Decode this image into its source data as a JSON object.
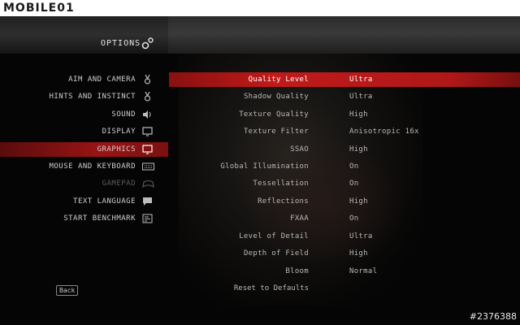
{
  "watermark": {
    "brand": "MOBILE01",
    "image_id": "#2376388"
  },
  "header": {
    "title": "OPTIONS"
  },
  "menu": {
    "items": [
      {
        "label": "AIM AND CAMERA",
        "icon": "medal-icon"
      },
      {
        "label": "HINTS AND INSTINCT",
        "icon": "medal-icon"
      },
      {
        "label": "SOUND",
        "icon": "speaker-icon"
      },
      {
        "label": "DISPLAY",
        "icon": "monitor-icon"
      },
      {
        "label": "GRAPHICS",
        "icon": "monitor-icon",
        "selected": true
      },
      {
        "label": "MOUSE AND KEYBOARD",
        "icon": "keyboard-icon"
      },
      {
        "label": "GAMEPAD",
        "icon": "gamepad-icon",
        "disabled": true
      },
      {
        "label": "TEXT LANGUAGE",
        "icon": "speech-bubble-icon"
      },
      {
        "label": "START BENCHMARK",
        "icon": "chart-icon"
      }
    ],
    "back_label": "Back"
  },
  "settings": [
    {
      "name": "Quality Level",
      "value": "Ultra",
      "selected": true
    },
    {
      "name": "Shadow Quality",
      "value": "Ultra"
    },
    {
      "name": "Texture Quality",
      "value": "High"
    },
    {
      "name": "Texture Filter",
      "value": "Anisotropic 16x"
    },
    {
      "name": "SSAO",
      "value": "High"
    },
    {
      "name": "Global Illumination",
      "value": "On"
    },
    {
      "name": "Tessellation",
      "value": "On"
    },
    {
      "name": "Reflections",
      "value": "High"
    },
    {
      "name": "FXAA",
      "value": "On"
    },
    {
      "name": "Level of Detail",
      "value": "Ultra"
    },
    {
      "name": "Depth of Field",
      "value": "High"
    },
    {
      "name": "Bloom",
      "value": "Normal"
    }
  ],
  "reset_label": "Reset to Defaults",
  "colors": {
    "accent_red": "#c01a1a",
    "menu_selected": "#9a1414",
    "text": "#c9c9c9",
    "disabled": "#5c5c5c"
  }
}
